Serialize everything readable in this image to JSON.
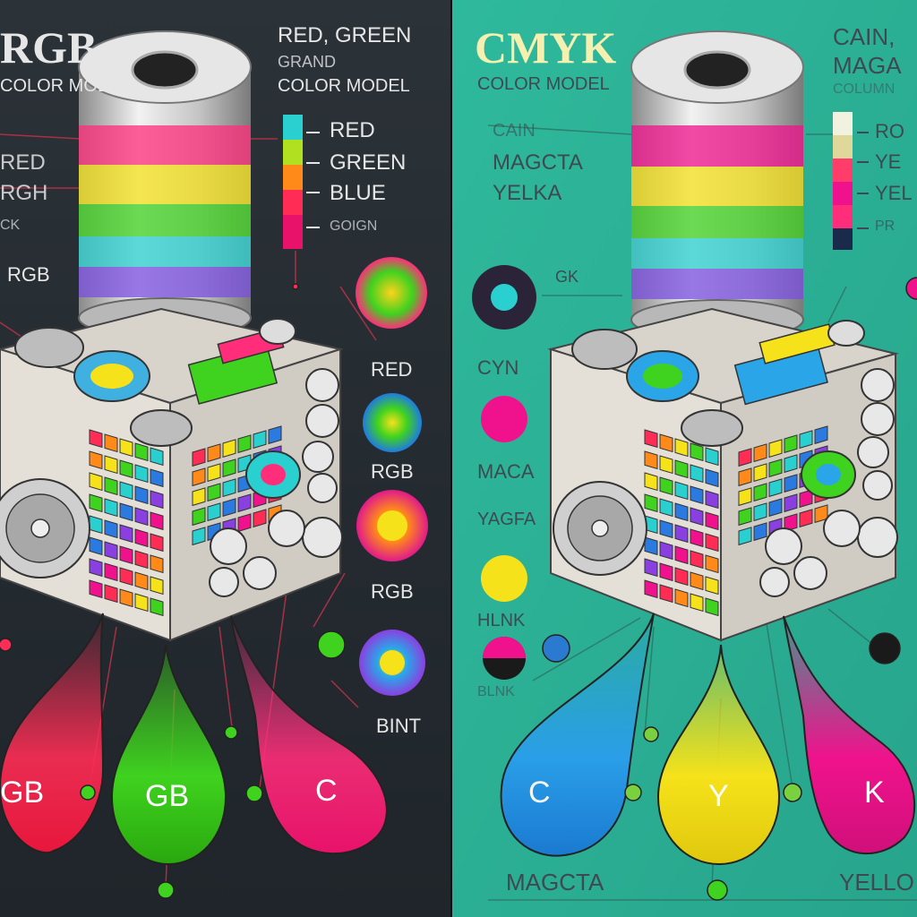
{
  "left": {
    "title": "RGB",
    "subtitle": "COLOR MODEL",
    "heading": [
      "RED, GREEN",
      "GRAND",
      "COLOR MODEL"
    ],
    "legend": [
      "RED",
      "GREEN",
      "BLUE",
      "GOIGN"
    ],
    "side_labels": [
      "RED",
      "RGH",
      "CK",
      "RGB"
    ],
    "circle_labels": [
      "RED",
      "RGB",
      "RGB",
      "BINT"
    ],
    "drop_labels": [
      "GB",
      "GB",
      "C"
    ]
  },
  "right": {
    "title": "CMYK",
    "subtitle": "COLOR MODEL",
    "heading": [
      "CAIN,",
      "MAGA",
      "COLUMN"
    ],
    "legend": [
      "RO",
      "YE",
      "YEL",
      "PR"
    ],
    "side_labels": [
      "CAIN",
      "MAGCTA",
      "YELKA",
      "GK"
    ],
    "circle_labels": [
      "CYN",
      "MACA",
      "YAGFA",
      "HLNK",
      "BLNK"
    ],
    "drop_labels": [
      "C",
      "Y",
      "K"
    ],
    "bottom_labels": [
      "MAGCTA",
      "YELLO"
    ]
  },
  "colors": {
    "left_bg": "#262d33",
    "right_bg": "#30b59a",
    "red": "#ff2d55",
    "green": "#3fd21f",
    "blue": "#2f8fe0",
    "cyan": "#2aa6e8",
    "yellow": "#f5e21a",
    "magenta": "#f0128c",
    "metal": "#d9d9d9"
  }
}
